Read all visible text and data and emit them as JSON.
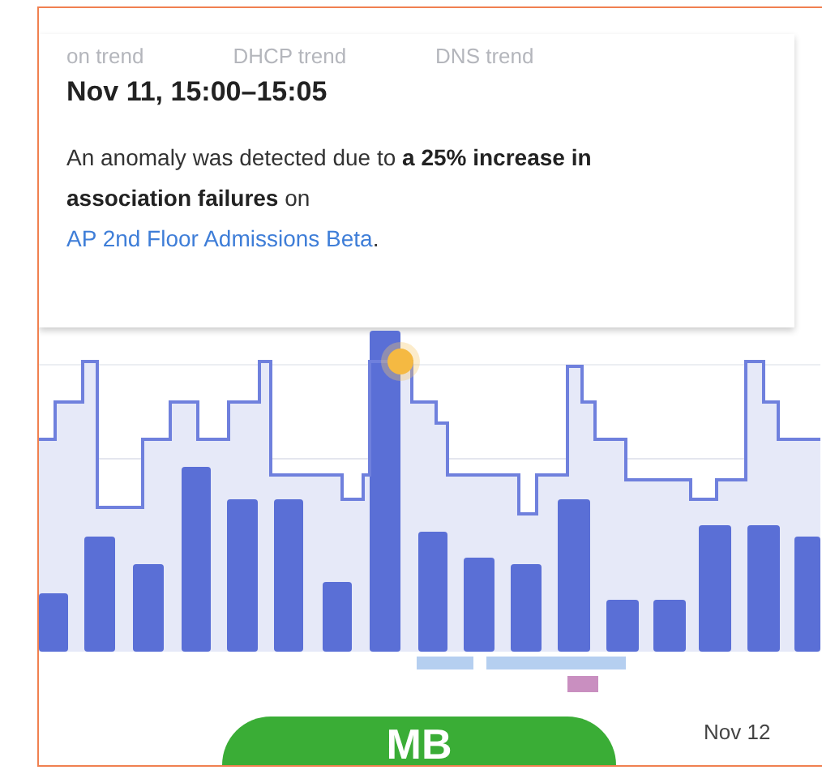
{
  "tooltip": {
    "background_tabs": [
      "on trend",
      "DHCP trend",
      "DNS trend"
    ],
    "title": "Nov 11, 15:00–15:05",
    "text": "An anomaly was detected due to **a 25% increase in association failures** on",
    "link": "AP 2nd Floor Admissions Beta",
    "text_end": "."
  },
  "chart": {
    "axis_label": "Nov 12"
  },
  "badge": {
    "label": "MB"
  }
}
